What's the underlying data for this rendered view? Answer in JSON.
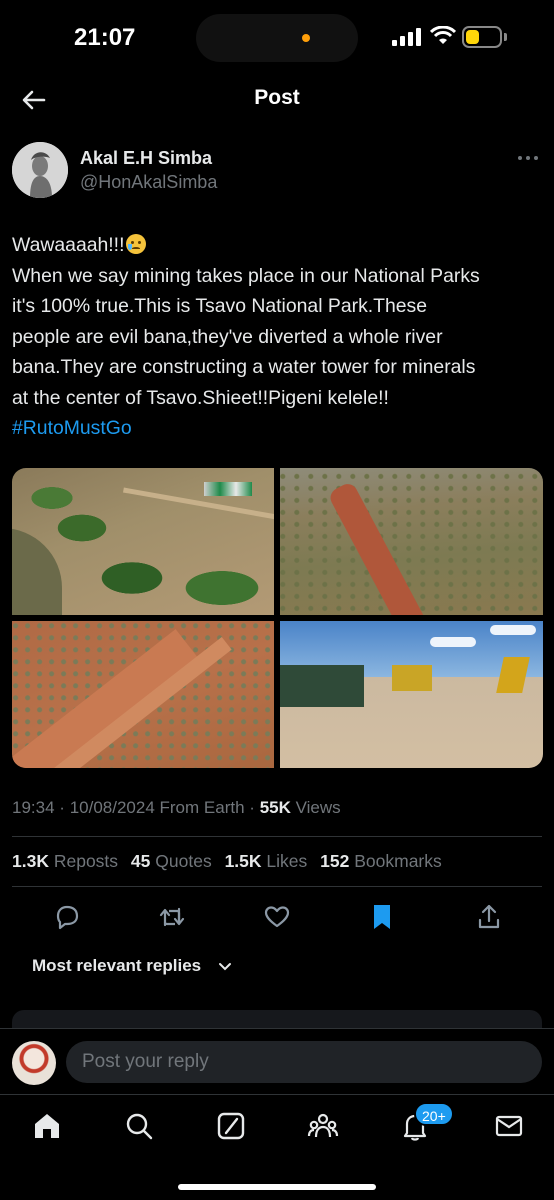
{
  "status_bar": {
    "time": "21:07",
    "battery_level": 0.4,
    "battery_color": "#ffd60a"
  },
  "header": {
    "title": "Post"
  },
  "author": {
    "name": "Akal E.H Simba",
    "handle": "@HonAkalSimba"
  },
  "post": {
    "lines": [
      "Wawaaaah!!!",
      "When we say mining takes place in our National Parks",
      "it's 100% true.This is Tsavo National Park.These",
      "people are evil bana,they've diverted a whole river",
      "bana.They are constructing a water tower for minerals",
      "at the center of Tsavo.Shieet!!Pigeni kelele!!"
    ],
    "hashtag": "#RutoMustGo",
    "emoji": "crying-face-emoji"
  },
  "meta": {
    "time": "19:34",
    "date": "10/08/2024",
    "source": "From Earth",
    "views_count": "55K",
    "views_label": "Views",
    "sep": "·"
  },
  "stats": {
    "reposts_count": "1.3K",
    "reposts_label": "Reposts",
    "quotes_count": "45",
    "quotes_label": "Quotes",
    "likes_count": "1.5K",
    "likes_label": "Likes",
    "bookmarks_count": "152",
    "bookmarks_label": "Bookmarks"
  },
  "actions": [
    "reply-icon",
    "repost-icon",
    "like-icon",
    "bookmark-icon",
    "share-icon"
  ],
  "replies": {
    "sort_label": "Most relevant replies"
  },
  "composer": {
    "placeholder": "Post your reply"
  },
  "tabbar": {
    "tabs": [
      "home-icon",
      "search-icon",
      "grok-icon",
      "communities-icon",
      "notifications-icon",
      "messages-icon"
    ],
    "notif_badge": "20+"
  },
  "colors": {
    "accent": "#1d9bf0",
    "background": "#000000",
    "muted": "#71767b",
    "text": "#e7e9ea"
  }
}
